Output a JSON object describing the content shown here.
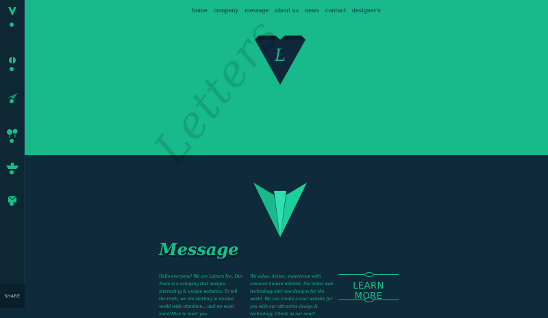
{
  "nav": [
    "home",
    "company",
    "message",
    "about us",
    "news",
    "contact",
    "designer's"
  ],
  "logo_letter": "L",
  "watermark": "Letters",
  "message": {
    "title": "Message",
    "col1": "Hello everyone! We are Letters Inc. Our Team is a company that designs interesting & unique websites. To tell the truth, we are starting to receive world wide attention... and we want more!Nice to meet you.",
    "col2": "We value: Action, experience with common human interest, the latest web technology and new designs for the world. We can create a cool website for you with our attractive design & technology. Check us out now!!"
  },
  "learn_more": "LEARN MORE",
  "share": "SHARE",
  "sidebar_icons": [
    "logo-icon",
    "globe-icon",
    "plane-icon",
    "balloons-icon",
    "boat-icon",
    "mail-icon"
  ],
  "colors": {
    "accent": "#18b98a",
    "dark": "#0f2a3a"
  }
}
